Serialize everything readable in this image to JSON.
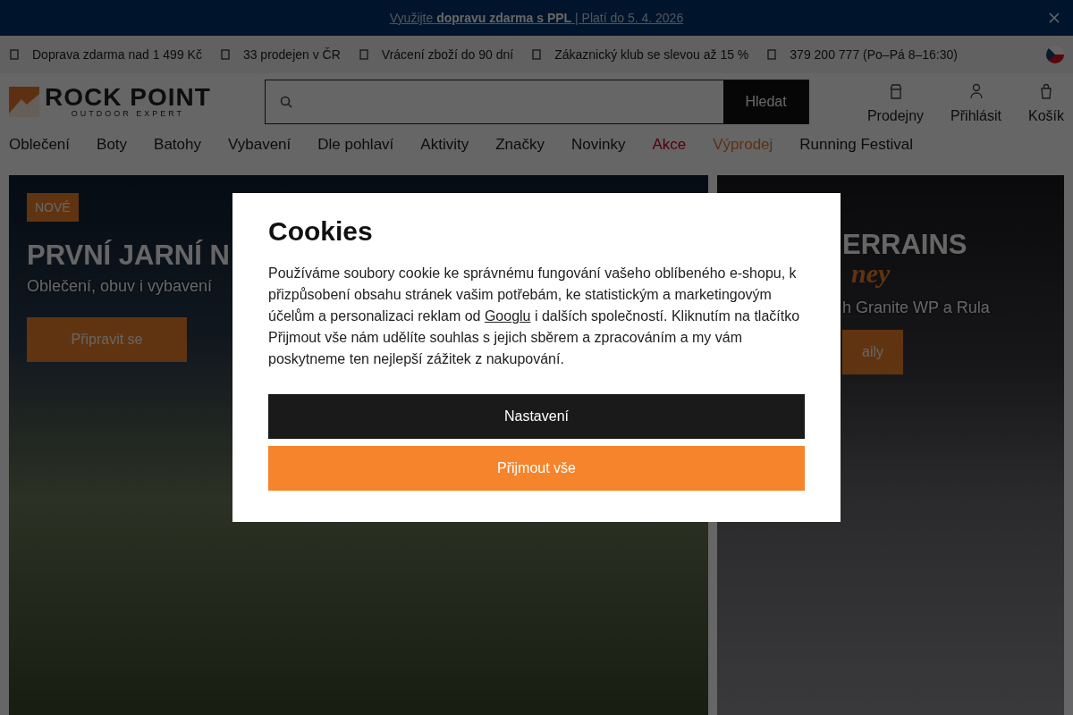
{
  "promo_banner": {
    "text": "Využijte **dopravu zdarma s PPL** | Platí do 5. 4. 2026"
  },
  "info_bar": {
    "items": [
      {
        "text": "Doprava zdarma nad 1 499 Kč"
      },
      {
        "text": "33 prodejen v ČR"
      },
      {
        "text": "Vrácení zboží do 90 dní"
      },
      {
        "text": "Zákaznický klub se slevou až 15 %"
      },
      {
        "text": "379 200 777 (Po–Pá 8–16:30)"
      }
    ]
  },
  "header": {
    "logo": {
      "name": "ROCK POINT",
      "tagline": "OUTDOOR EXPERT"
    },
    "search": {
      "button": "Hledat"
    },
    "actions": [
      {
        "kind": "store",
        "label": "Prodejny"
      },
      {
        "kind": "user",
        "label": "Přihlásit"
      },
      {
        "kind": "cart",
        "label": "Košík"
      }
    ]
  },
  "nav": [
    {
      "label": "Oblečení",
      "kind": "normal"
    },
    {
      "label": "Boty",
      "kind": "normal"
    },
    {
      "label": "Batohy",
      "kind": "normal"
    },
    {
      "label": "Vybavení",
      "kind": "normal"
    },
    {
      "label": "Dle pohlaví",
      "kind": "normal"
    },
    {
      "label": "Aktivity",
      "kind": "normal"
    },
    {
      "label": "Značky",
      "kind": "normal"
    },
    {
      "label": "Novinky",
      "kind": "normal"
    },
    {
      "label": "Akce",
      "kind": "sale"
    },
    {
      "label": "Výprodej",
      "kind": "clearance"
    },
    {
      "label": "Running Festival",
      "kind": "normal"
    }
  ],
  "hero_left": {
    "badge": "NOVÉ",
    "title": "PRVNÍ JARNÍ N",
    "subtitle": "Oblečení, obuv i vybavení",
    "button": "Připravit se"
  },
  "hero_right": {
    "title": "ERRAINS",
    "script": "ney",
    "subtitle": "h Granite WP a Rula",
    "button": "aily"
  },
  "cookie_dialog": {
    "title": "Cookies",
    "text_before": "Používáme soubory cookie ke správnému fungování vašeho oblíbeného e-shopu, k přizpůsobení obsahu stránek vašim potřebám, ke statistickým a marketingovým účelům a personalizaci reklam od",
    "link": "Googlu",
    "text_after": "i dalších společností. Kliknutím na tlačítko Přijmout vše nám udělíte souhlas s jejich sběrem a zpracováním a my vám poskytneme ten nejlepší zážitek z nakupování.",
    "buttons": [
      {
        "kind": "secondary",
        "label": "Nastavení"
      },
      {
        "kind": "primary",
        "label": "Přijmout vše"
      }
    ]
  }
}
